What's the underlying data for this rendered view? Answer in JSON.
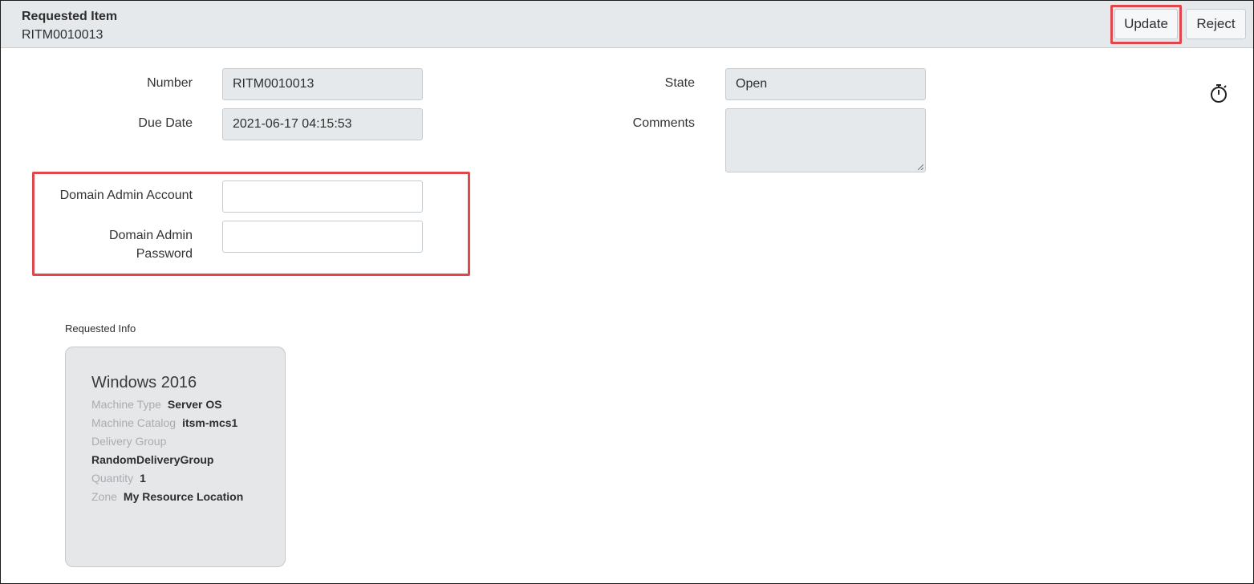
{
  "header": {
    "title": "Requested Item",
    "subtitle": "RITM0010013",
    "update_label": "Update",
    "reject_label": "Reject"
  },
  "form": {
    "number": {
      "label": "Number",
      "value": "RITM0010013"
    },
    "due_date": {
      "label": "Due Date",
      "value": "2021-06-17 04:15:53"
    },
    "state": {
      "label": "State",
      "value": "Open"
    },
    "comments": {
      "label": "Comments",
      "value": ""
    },
    "domain_admin_account": {
      "label": "Domain Admin Account",
      "value": ""
    },
    "domain_admin_password": {
      "label_line1": "Domain Admin",
      "label_line2": "Password",
      "value": ""
    }
  },
  "requested_info": {
    "section_label": "Requested Info",
    "card_title": "Windows 2016",
    "rows": [
      {
        "key": "Machine Type",
        "value": "Server OS"
      },
      {
        "key": "Machine Catalog",
        "value": "itsm-mcs1"
      },
      {
        "key": "Delivery Group",
        "value": "RandomDeliveryGroup"
      },
      {
        "key": "Quantity",
        "value": "1"
      },
      {
        "key": "Zone",
        "value": "My Resource Location"
      }
    ]
  },
  "icons": {
    "timer": "stopwatch-icon"
  },
  "colors": {
    "highlight": "#e0474c",
    "header_bg": "#e5e9ec",
    "readonly_bg": "#e5e9ec"
  }
}
